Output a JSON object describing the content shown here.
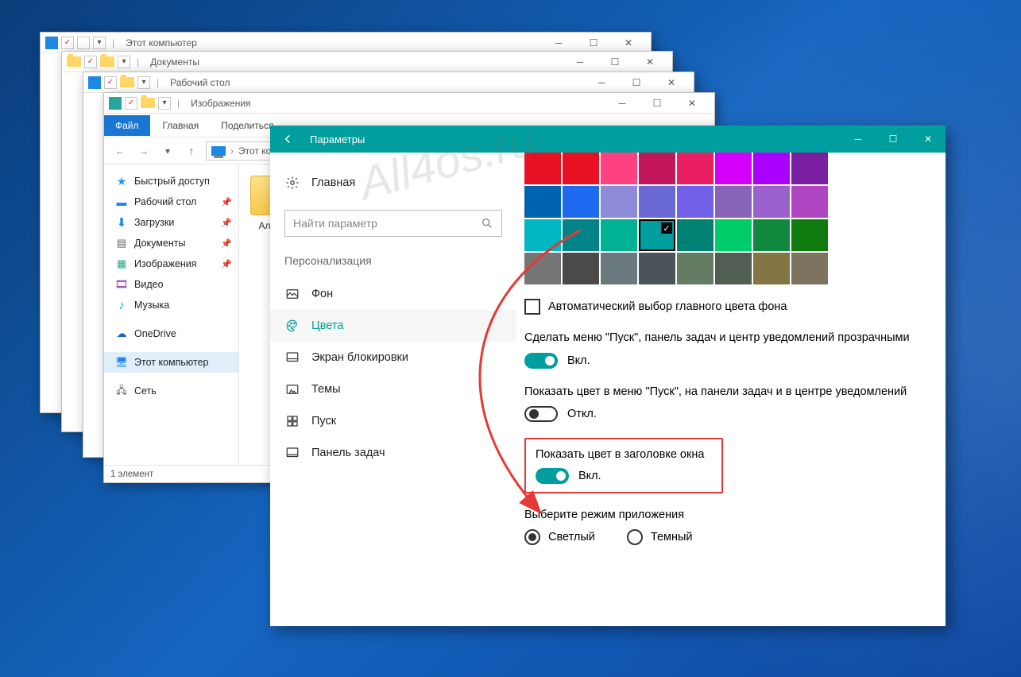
{
  "watermark": "All4os.ru",
  "explorer_windows": [
    {
      "title": "Этот компьютер"
    },
    {
      "title": "Документы"
    },
    {
      "title": "Рабочий стол"
    },
    {
      "title": "Изображения"
    }
  ],
  "ribbon": {
    "file": "Файл",
    "tabs": [
      "Главная",
      "Поделиться"
    ]
  },
  "breadcrumb": "Этот компьютер",
  "sidebar": {
    "quick_access": "Быстрый доступ",
    "items": [
      {
        "label": "Рабочий стол",
        "pinned": true
      },
      {
        "label": "Загрузки",
        "pinned": true
      },
      {
        "label": "Документы",
        "pinned": true
      },
      {
        "label": "Изображения",
        "pinned": true
      },
      {
        "label": "Видео",
        "pinned": false
      },
      {
        "label": "Музыка",
        "pinned": false
      }
    ],
    "onedrive": "OneDrive",
    "this_pc": "Этот компьютер",
    "network": "Сеть"
  },
  "content_folder": "Альбом",
  "status": "1 элемент",
  "settings": {
    "title": "Параметры",
    "nav": {
      "home": "Главная",
      "search_placeholder": "Найти параметр",
      "section": "Персонализация",
      "items": [
        {
          "label": "Фон"
        },
        {
          "label": "Цвета",
          "active": true
        },
        {
          "label": "Экран блокировки"
        },
        {
          "label": "Темы"
        },
        {
          "label": "Пуск"
        },
        {
          "label": "Панель задач"
        }
      ]
    },
    "colors": {
      "palette": [
        "#e81123",
        "#e81123",
        "#ff4081",
        "#c2185b",
        "#e91e63",
        "#d500f9",
        "#aa00ff",
        "#7b1fa2",
        "#0063b1",
        "#1f6bf0",
        "#8e8cd8",
        "#6b69d6",
        "#7160e8",
        "#8764b8",
        "#9a60cc",
        "#b146c2",
        "#00b7c3",
        "#038387",
        "#00b294",
        "#009e9e",
        "#008272",
        "#00cc6a",
        "#10893e",
        "#107c10",
        "#767676",
        "#4c4a48",
        "#69797e",
        "#4a5459",
        "#647c64",
        "#525e54",
        "#847545",
        "#7e735f"
      ],
      "selected_index": 19,
      "auto_pick": "Автоматический выбор главного цвета фона",
      "transparency_label": "Сделать меню \"Пуск\", панель задач и центр уведомлений прозрачными",
      "transparency_state": "Вкл.",
      "show_color_label": "Показать цвет в меню \"Пуск\", на панели задач и в центре уведомлений",
      "show_color_state": "Откл.",
      "titlebar_label": "Показать цвет в заголовке окна",
      "titlebar_state": "Вкл.",
      "mode_heading": "Выберите режим приложения",
      "mode_light": "Светлый",
      "mode_dark": "Темный"
    }
  }
}
